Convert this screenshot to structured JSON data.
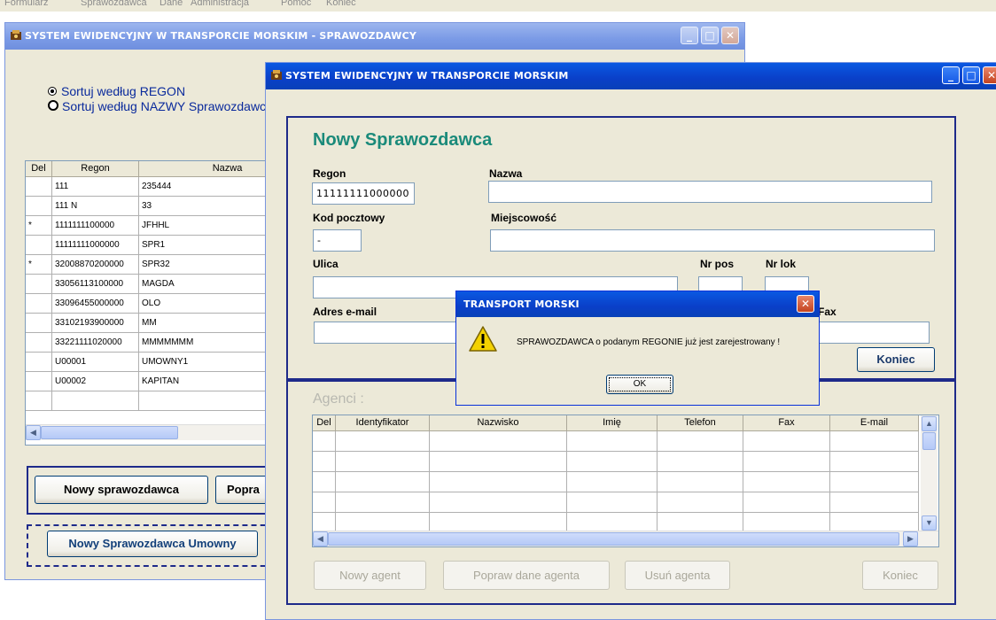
{
  "menubar": {
    "items": [
      "Formularz",
      "Sprawozdawca",
      "Dane",
      "Administracja",
      "Pomoc",
      "Koniec"
    ]
  },
  "back_window": {
    "title": "SYSTEM EWIDENCYJNY W TRANSPORCIE MORSKIM - SPRAWOZDAWCY",
    "sort_regon": "Sortuj według REGON",
    "sort_nazwa": "Sortuj według NAZWY Sprawozdawcy",
    "sort_selected": "regon",
    "columns": [
      "Del",
      "Regon",
      "Nazwa"
    ],
    "rows": [
      {
        "del": "",
        "regon": "111",
        "nazwa": "235444"
      },
      {
        "del": "",
        "regon": "111         N",
        "nazwa": "33"
      },
      {
        "del": "*",
        "regon": "1111111100000",
        "nazwa": "JFHHL"
      },
      {
        "del": "",
        "regon": "11111111000000",
        "nazwa": "SPR1"
      },
      {
        "del": "*",
        "regon": "32008870200000",
        "nazwa": "SPR32"
      },
      {
        "del": "",
        "regon": "33056113100000",
        "nazwa": "MAGDA"
      },
      {
        "del": "",
        "regon": "33096455000000",
        "nazwa": "OLO"
      },
      {
        "del": "",
        "regon": "33102193900000",
        "nazwa": "MM"
      },
      {
        "del": "",
        "regon": "33221111020000",
        "nazwa": "MMMMMMM"
      },
      {
        "del": "",
        "regon": "U00001",
        "nazwa": "UMOWNY1"
      },
      {
        "del": "",
        "regon": "U00002",
        "nazwa": "KAPITAN"
      }
    ],
    "btn_new": "Nowy sprawozdawca",
    "btn_fix": "Popra",
    "btn_new_contract": "Nowy Sprawozdawca Umowny"
  },
  "front_window": {
    "title": "SYSTEM EWIDENCYJNY W TRANSPORCIE MORSKIM",
    "heading": "Nowy Sprawozdawca",
    "labels": {
      "regon": "Regon",
      "nazwa": "Nazwa",
      "kod": "Kod pocztowy",
      "miejscowosc": "Miejscowość",
      "ulica": "Ulica",
      "nr_pos": "Nr pos",
      "nr_lok": "Nr lok",
      "email": "Adres e-mail",
      "fax": "Fax"
    },
    "values": {
      "regon": "11111111000000",
      "nazwa": "",
      "kod": "  -",
      "miejscowosc": "",
      "ulica": "",
      "nr_pos": "",
      "nr_lok": "",
      "email": "",
      "fax": ""
    },
    "btn_koniec": "Koniec",
    "agents_heading": "Agenci :",
    "agent_columns": [
      "Del",
      "Identyfikator",
      "Nazwisko",
      "Imię",
      "Telefon",
      "Fax",
      "E-mail"
    ],
    "btn_new_agent": "Nowy agent",
    "btn_fix_agent": "Popraw dane agenta",
    "btn_del_agent": "Usuń agenta",
    "btn_koniec2": "Koniec"
  },
  "dialog": {
    "title": "TRANSPORT MORSKI",
    "message": "SPRAWOZDAWCA o podanym REGONIE już jest zarejestrowany !",
    "ok": "OK"
  },
  "colors": {
    "title_active": "#0a4fd8",
    "heading": "#1a8a7a",
    "frame": "#1e2a8a"
  }
}
